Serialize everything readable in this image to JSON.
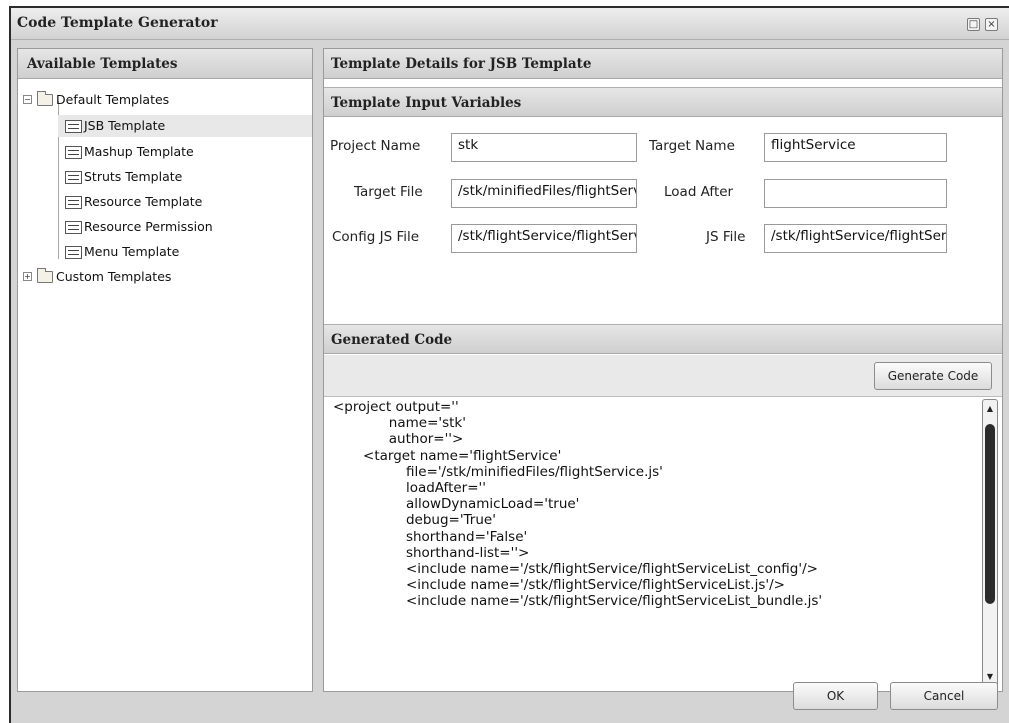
{
  "window": {
    "title": "Code Template Generator",
    "restore_glyph": "□",
    "close_glyph": "×"
  },
  "left_panel": {
    "header": "Available Templates",
    "tree": {
      "default_folder": {
        "label": "Default Templates",
        "expander": "−"
      },
      "default_items": [
        {
          "label": "JSB Template",
          "selected": true
        },
        {
          "label": "Mashup Template"
        },
        {
          "label": "Struts Template"
        },
        {
          "label": "Resource Template"
        },
        {
          "label": "Resource Permission"
        },
        {
          "label": "Menu Template"
        }
      ],
      "custom_folder": {
        "label": "Custom Templates",
        "expander": "+"
      }
    }
  },
  "right_panel": {
    "details_header": "Template Details for JSB Template",
    "inputs_header": "Template Input Variables",
    "fields": {
      "project_name": {
        "label": "Project Name",
        "value": "stk"
      },
      "target_name": {
        "label": "Target Name",
        "value": "flightService"
      },
      "target_file": {
        "label": "Target File",
        "value": "/stk/minifiedFiles/flightService.js"
      },
      "load_after": {
        "label": "Load After",
        "value": ""
      },
      "config_js_file": {
        "label": "Config JS File",
        "value": "/stk/flightService/flightServiceList_config"
      },
      "js_file": {
        "label": "JS File",
        "value": "/stk/flightService/flightServiceList.js"
      }
    },
    "generated_header": "Generated Code",
    "generate_button": "Generate Code",
    "code_lines": [
      "<project output=''",
      "             name='stk'",
      "             author=''>",
      "       <target name='flightService'",
      "                 file='/stk/minifiedFiles/flightService.js'",
      "                 loadAfter=''",
      "                 allowDynamicLoad='true'",
      "                 debug='True'",
      "                 shorthand='False'",
      "                 shorthand-list=''>",
      "                 <include name='/stk/flightService/flightServiceList_config'/>",
      "                 <include name='/stk/flightService/flightServiceList.js'/>",
      "                 <include name='/stk/flightService/flightServiceList_bundle.js'"
    ]
  },
  "footer": {
    "ok_label": "OK",
    "cancel_label": "Cancel"
  },
  "colors": {
    "chrome": "#d4d4d4",
    "header_gradient_top": "#e6e6e6",
    "header_gradient_bottom": "#cfcfcf",
    "selected_row": "#e8e8e8"
  }
}
